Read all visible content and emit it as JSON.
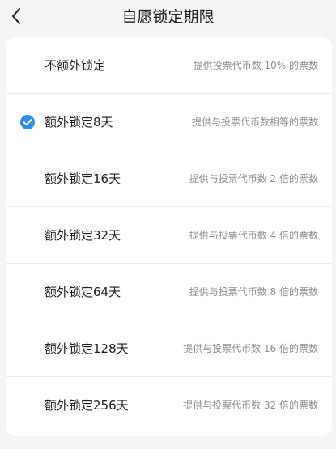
{
  "header": {
    "title": "自愿锁定期限",
    "back_icon": "chevron-left-icon"
  },
  "colors": {
    "background": "#f5f5f7",
    "card": "#ffffff",
    "accent": "#2f8de4",
    "text_primary": "#1d1d1f",
    "text_secondary": "#8e8e93"
  },
  "options": [
    {
      "label": "不额外锁定",
      "description": "提供投票代币数 10% 的票数",
      "selected": false
    },
    {
      "label": "额外锁定8天",
      "description": "提供与投票代币数相等的票数",
      "selected": true
    },
    {
      "label": "额外锁定16天",
      "description": "提供与投票代币数 2 倍的票数",
      "selected": false
    },
    {
      "label": "额外锁定32天",
      "description": "提供与投票代币数 4 倍的票数",
      "selected": false
    },
    {
      "label": "额外锁定64天",
      "description": "提供与投票代币数 8 倍的票数",
      "selected": false
    },
    {
      "label": "额外锁定128天",
      "description": "提供与投票代币数 16 倍的票数",
      "selected": false
    },
    {
      "label": "额外锁定256天",
      "description": "提供与投票代币数 32 倍的票数",
      "selected": false
    }
  ]
}
